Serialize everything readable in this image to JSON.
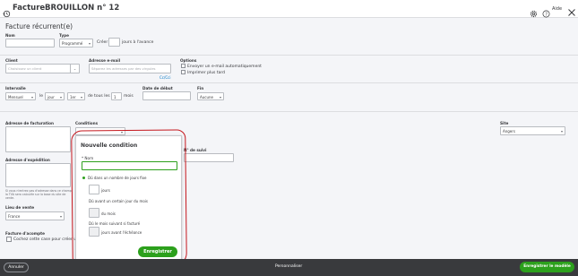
{
  "header": {
    "title": "Facture",
    "subtitle": "BROUILLON n° 12",
    "help_label": "Aide"
  },
  "form": {
    "heading": "Facture récurrent(e)",
    "name_label": "Nom",
    "type_label": "Type",
    "type_value": "Programmé",
    "create_label": "Créer",
    "create_suffix": "jours à l'avance",
    "client_label": "Client",
    "client_placeholder": "Choisissez un client",
    "email_label": "Adresse e-mail",
    "email_placeholder": "Séparez les adresses par des virgules",
    "cc_label": "Cc/Cci",
    "options_label": "Options",
    "option_email_auto": "Envoyer un e-mail automatiquement",
    "option_print_later": "Imprimer plus tard",
    "interval_label": "Intervalle",
    "interval_value": "Mensuel",
    "le_label": "le",
    "day_select_value": "jour",
    "first_select_value": "1er",
    "every_label": "de tous les",
    "every_value": "1",
    "months_label": "mois",
    "start_label": "Date de début",
    "end_label": "Fin",
    "end_value": "Aucune",
    "billing_address_label": "Adresse de facturation",
    "conditions_label": "Conditions",
    "shipping_address_label": "Adresse d'expédition",
    "shipping_note": "Si vous n'entrez pas d'adresse dans ce champ, la TVA sera calculée sur la base du site de vente.",
    "tracking_label": "N° de suivi",
    "site_label": "Site",
    "site_value": "Angers",
    "sale_place_label": "Lieu de vente",
    "sale_place_value": "France",
    "deposit_label": "Facture d'acompte",
    "deposit_checkbox_label": "Cochez cette case pour créer un"
  },
  "modal": {
    "title": "Nouvelle condition",
    "name_label": "* Nom",
    "option_due_days": "Dû dans un nombre de jours fixe",
    "days_suffix": "jours",
    "option_due_day_of_month": "Dû avant un certain jour du mois",
    "of_month_suffix": "du mois",
    "option_due_next_month": "Dû le mois suivant si facturé",
    "days_before_suffix": "jours avant l'échéance",
    "save_label": "Enregistrer"
  },
  "footer": {
    "cancel_label": "Annuler",
    "customize_label": "Personnaliser",
    "save_template_label": "Enregistrer le modèle"
  },
  "colors": {
    "accent_green": "#2ca01c",
    "annotation_red": "#c4161c",
    "footer_bg": "#393a3d"
  },
  "icons": {
    "back": "history-icon",
    "settings": "gear-icon",
    "help": "help-icon",
    "close": "close-icon"
  }
}
